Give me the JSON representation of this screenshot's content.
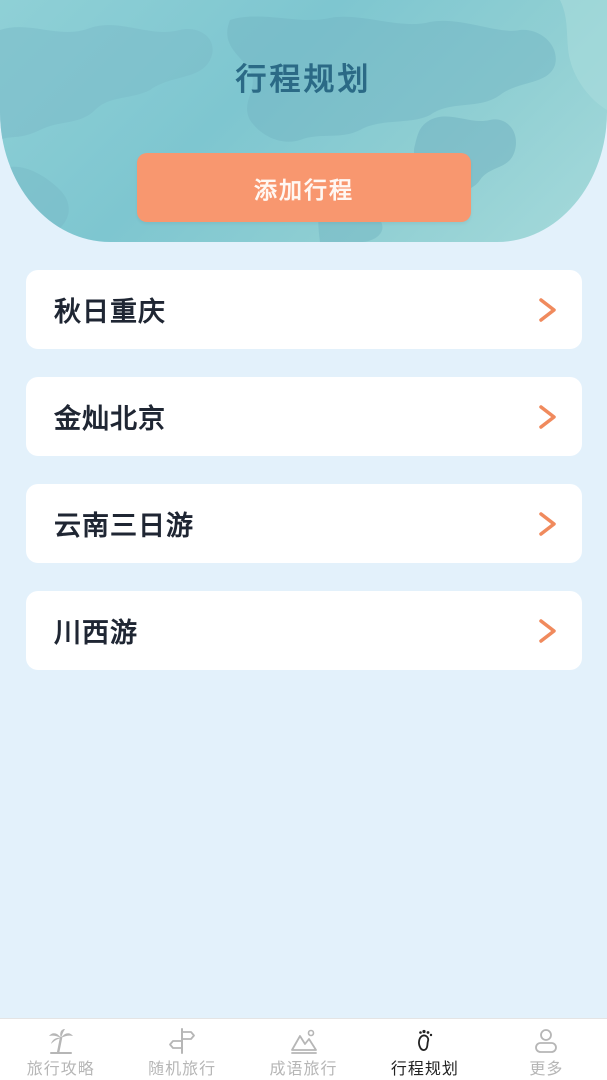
{
  "header": {
    "title": "行程规划",
    "add_button_label": "添加行程"
  },
  "trips": [
    {
      "label": "秋日重庆"
    },
    {
      "label": "金灿北京"
    },
    {
      "label": "云南三日游"
    },
    {
      "label": "川西游"
    }
  ],
  "bottom_nav": {
    "items": [
      {
        "label": "旅行攻略",
        "icon": "palm-tree-icon",
        "active": false
      },
      {
        "label": "随机旅行",
        "icon": "signpost-icon",
        "active": false
      },
      {
        "label": "成语旅行",
        "icon": "mountain-icon",
        "active": false
      },
      {
        "label": "行程规划",
        "icon": "footprint-icon",
        "active": true
      },
      {
        "label": "更多",
        "icon": "user-icon",
        "active": false
      }
    ]
  },
  "colors": {
    "accent": "#f8976f",
    "title": "#2b6a86",
    "background": "#e3f1fb",
    "header": "#86cad3",
    "chevron": "#f08a5d"
  }
}
